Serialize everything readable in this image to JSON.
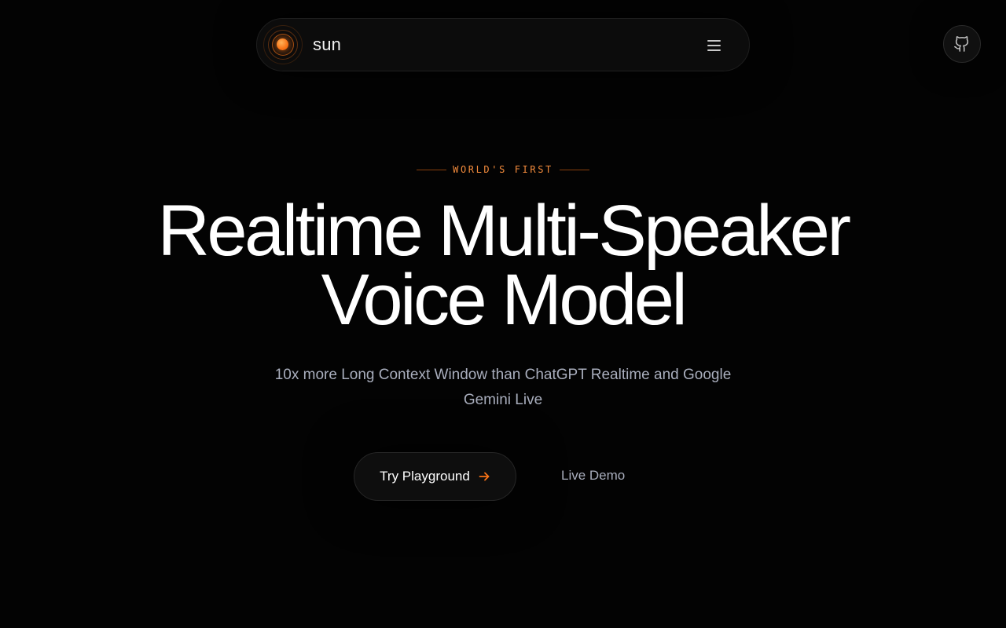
{
  "nav": {
    "brand_name": "sun",
    "menu_icon": "hamburger-menu-icon",
    "github_icon": "github-icon"
  },
  "hero": {
    "eyebrow": "WORLD'S FIRST",
    "headline_line1": "Realtime Multi-Speaker",
    "headline_line2": "Voice Model",
    "subtitle": "10x more Long Context Window than ChatGPT Realtime and Google Gemini Live"
  },
  "actions": {
    "primary_label": "Try Playground",
    "primary_icon": "arrow-right-icon",
    "secondary_label": "Live Demo"
  },
  "colors": {
    "background": "#030303",
    "accent": "#f97316",
    "muted_text": "#a9aebd",
    "headline": "#ffffff"
  }
}
